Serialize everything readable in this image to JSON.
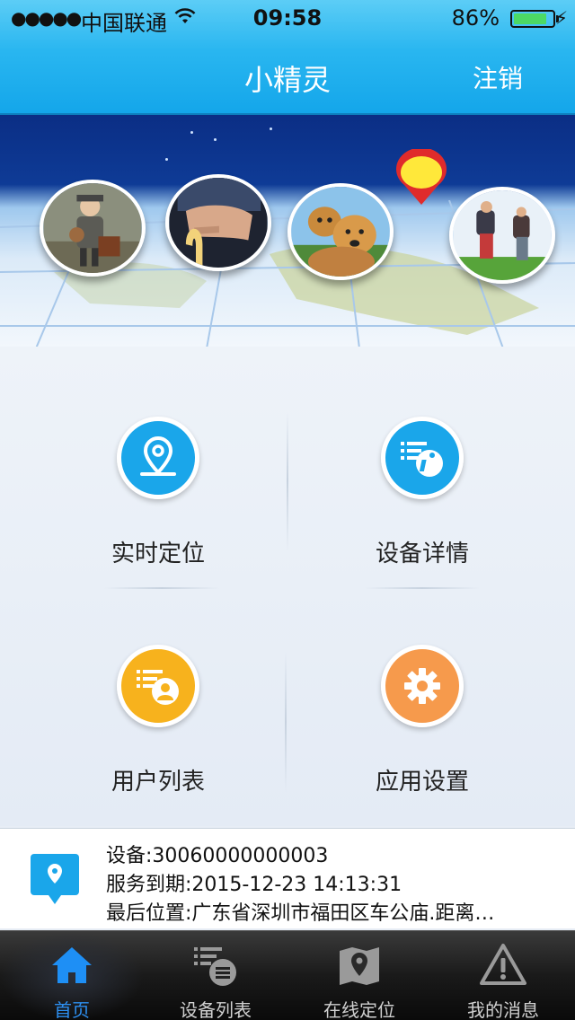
{
  "status_bar": {
    "signal": "●●●●●",
    "carrier": "中国联通",
    "time": "09:58",
    "battery_percent": "86%",
    "battery_level": 0.86
  },
  "nav": {
    "title": "小精灵",
    "logout_label": "注销"
  },
  "banner": {
    "photos": [
      "child-photo",
      "elderly-hands-photo",
      "dogs-photo",
      "hikers-photo"
    ],
    "pin_icon": "location-pin-icon"
  },
  "menu": {
    "items": [
      {
        "label": "实时定位",
        "icon": "location-icon",
        "color": "#1aa6ea"
      },
      {
        "label": "设备详情",
        "icon": "device-info-icon",
        "color": "#1aa6ea"
      },
      {
        "label": "用户列表",
        "icon": "user-list-icon",
        "color": "#f7b21d"
      },
      {
        "label": "应用设置",
        "icon": "gear-icon",
        "color": "#f69a4c"
      }
    ]
  },
  "device": {
    "id_line": "设备:30060000000003",
    "expiry_line": "服务到期:2015-12-23 14:13:31",
    "location_line": "最后位置:广东省深圳市福田区车公庙.距离…"
  },
  "tabbar": {
    "items": [
      {
        "label": "首页",
        "icon": "home-icon",
        "active": true
      },
      {
        "label": "设备列表",
        "icon": "device-list-icon",
        "active": false
      },
      {
        "label": "在线定位",
        "icon": "map-pin-icon",
        "active": false
      },
      {
        "label": "我的消息",
        "icon": "warning-icon",
        "active": false
      }
    ]
  },
  "colors": {
    "nav_blue": "#29b6f0",
    "tab_active": "#2d8ff0",
    "location_blue": "#1aa6ea",
    "user_yellow": "#f7b21d",
    "settings_orange": "#f69a4c"
  }
}
